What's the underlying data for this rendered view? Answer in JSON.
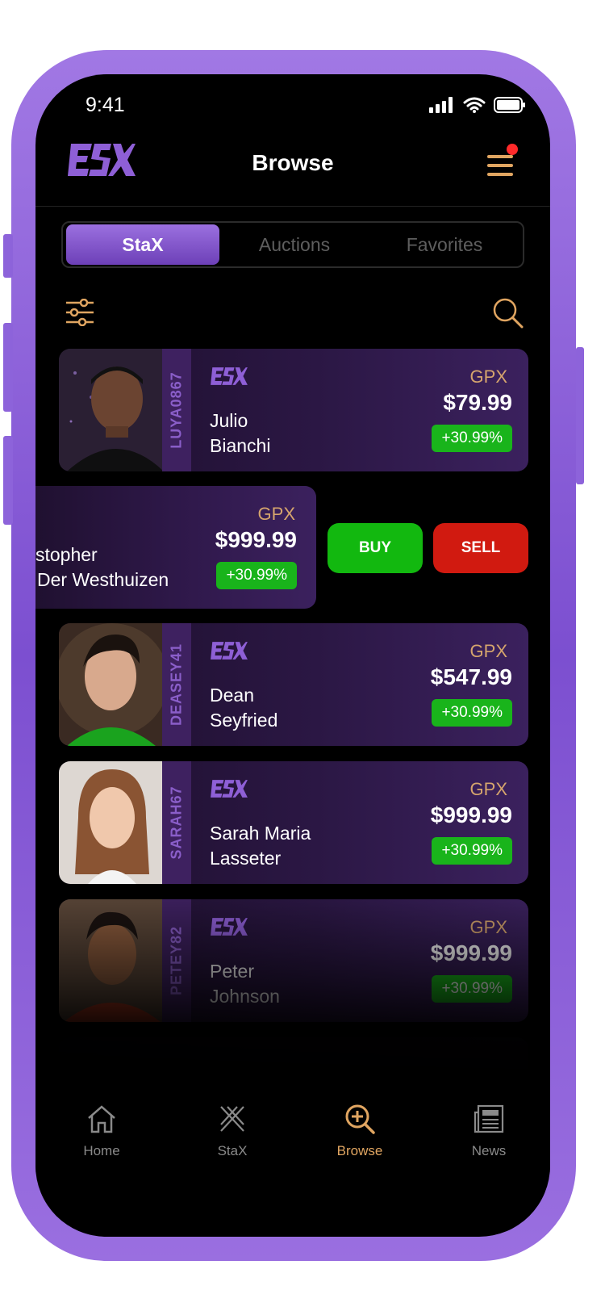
{
  "status_bar": {
    "time": "9:41"
  },
  "header": {
    "logo_text": "ESX",
    "title": "Browse"
  },
  "tabs": [
    "StaX",
    "Auctions",
    "Favorites"
  ],
  "cards": [
    {
      "handle": "LUYA0867",
      "first_name": "Julio",
      "last_name": "Bianchi",
      "currency": "GPX",
      "price": "$79.99",
      "change": "+30.99%"
    },
    {
      "handle": "DEASEY41",
      "first_name": "Dean",
      "last_name": "Seyfried",
      "currency": "GPX",
      "price": "$547.99",
      "change": "+30.99%"
    },
    {
      "handle": "SARAH67",
      "first_name": "Sarah Maria",
      "last_name": "Lasseter",
      "currency": "GPX",
      "price": "$999.99",
      "change": "+30.99%"
    },
    {
      "handle": "PETEY82",
      "first_name": "Peter",
      "last_name": "Johnson",
      "currency": "GPX",
      "price": "$999.99",
      "change": "+30.99%"
    }
  ],
  "swiped_card": {
    "first_line": "stopher",
    "second_line": "Der Westhuizen",
    "currency": "GPX",
    "price": "$999.99",
    "change": "+30.99%",
    "buy_label": "BUY",
    "sell_label": "SELL"
  },
  "bottom_nav": [
    {
      "label": "Home",
      "icon": "home-icon",
      "active": false
    },
    {
      "label": "StaX",
      "icon": "stax-icon",
      "active": false
    },
    {
      "label": "Browse",
      "icon": "browse-icon",
      "active": true
    },
    {
      "label": "News",
      "icon": "news-icon",
      "active": false
    }
  ],
  "colors": {
    "accent_purple": "#7c4fd0",
    "accent_orange": "#e0a561",
    "positive": "#19b41b",
    "negative": "#d11a10"
  }
}
